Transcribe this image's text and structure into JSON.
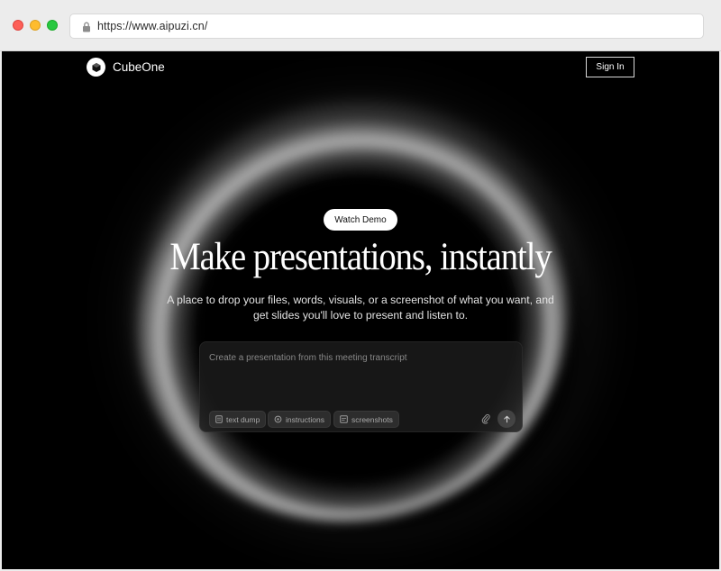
{
  "browser": {
    "url": "https://www.aipuzi.cn/"
  },
  "nav": {
    "brand": "CubeOne",
    "sign_in": "Sign In"
  },
  "hero": {
    "watch_demo": "Watch Demo",
    "headline": "Make presentations, instantly",
    "subtitle_line1": "A place to drop your files, words, visuals, or a screenshot of what you want, and",
    "subtitle_line2": "get slides you'll love to present and listen to."
  },
  "prompt": {
    "placeholder": "Create a presentation from this meeting transcript",
    "chips": [
      "text dump",
      "instructions",
      "screenshots"
    ]
  },
  "icons": {
    "lock": "lock-icon",
    "logo": "cube-logo-icon",
    "chip1": "document-icon",
    "chip2": "settings-icon",
    "chip3": "image-icon",
    "attach": "paperclip-icon",
    "send": "arrow-up-icon"
  },
  "colors": {
    "background": "#000000",
    "text": "#ffffff",
    "button_light": "#ffffff"
  }
}
